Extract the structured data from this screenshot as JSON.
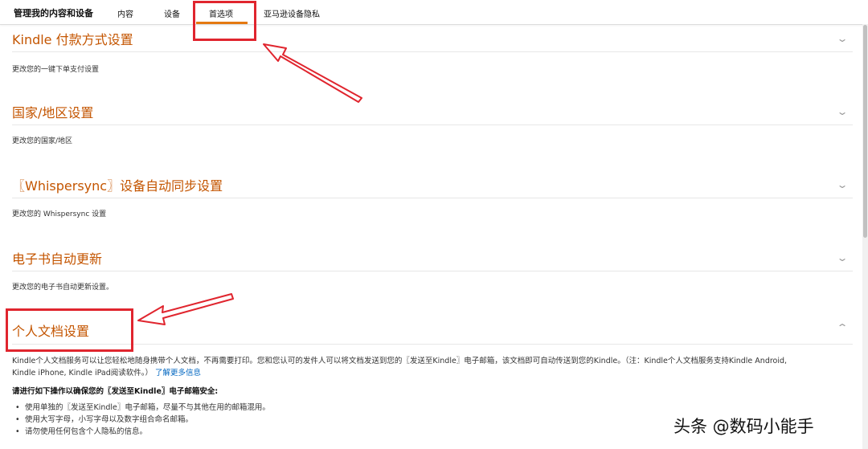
{
  "nav": {
    "title": "管理我的内容和设备",
    "tabs": [
      "内容",
      "设备",
      "首选项",
      "亚马逊设备隐私"
    ],
    "active_tab": "首选项",
    "accent_color": "#e47911"
  },
  "sections": [
    {
      "title": "Kindle 付款方式设置",
      "description": "更改您的一键下单支付设置",
      "expanded": false,
      "icon": "chevron-down-icon"
    },
    {
      "title": "国家/地区设置",
      "description": "更改您的国家/地区",
      "expanded": false,
      "icon": "chevron-down-icon"
    },
    {
      "title": "〖Whispersync〗设备自动同步设置",
      "description": "更改您的 Whispersync 设置",
      "expanded": false,
      "icon": "chevron-down-icon"
    },
    {
      "title": "电子书自动更新",
      "description": "更改您的电子书自动更新设置。",
      "expanded": false,
      "icon": "chevron-down-icon"
    },
    {
      "title": "个人文档设置",
      "expanded": true,
      "icon": "chevron-up-icon"
    }
  ],
  "personal_docs": {
    "intro_line1": "Kindle个人文档服务可以让您轻松地随身携带个人文档，不再需要打印。您和您认可的发件人可以将文档发送到您的〖发送至Kindle〗电子邮箱，该文档即可自动传送到您的Kindle。（注：Kindle个人文档服务支持Kindle Android,",
    "intro_line2": "Kindle iPhone, Kindle iPad阅读软件。）",
    "learn_more": "了解更多信息",
    "safety_heading": "请进行如下操作以确保您的〖发送至Kindle〗电子邮箱安全:",
    "bullets": [
      "使用单独的〖发送至Kindle〗电子邮箱，尽量不与其他在用的邮箱混用。",
      "使用大写字母，小写字母以及数字组合命名邮箱。",
      "请勿使用任何包含个人隐私的信息。"
    ]
  },
  "watermark": "头条 @数码小能手",
  "annotation_color": "#e0252e"
}
